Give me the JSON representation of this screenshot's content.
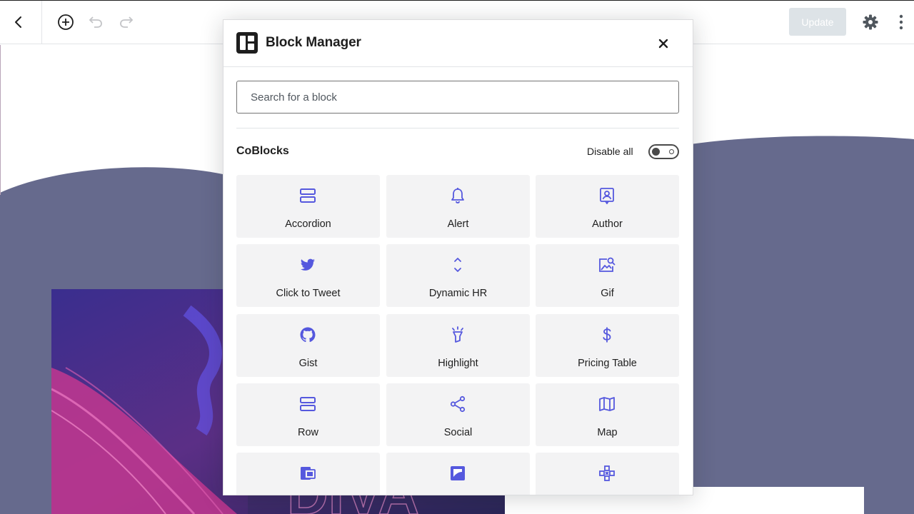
{
  "toolbar": {
    "back_icon": "chevron-left-icon",
    "add_icon": "plus-circle-icon",
    "undo_icon": "undo-icon",
    "redo_icon": "redo-icon",
    "update_label": "Update",
    "settings_icon": "gear-icon",
    "more_icon": "vertical-ellipsis-icon"
  },
  "modal": {
    "title": "Block Manager",
    "logo_icon": "coblocks-logo-icon",
    "close_icon": "close-icon",
    "search_placeholder": "Search for a block",
    "category": {
      "title": "CoBlocks",
      "disable_all_label": "Disable all",
      "toggle_on": true
    },
    "blocks": [
      {
        "label": "Accordion",
        "icon": "accordion-icon"
      },
      {
        "label": "Alert",
        "icon": "bell-icon"
      },
      {
        "label": "Author",
        "icon": "author-icon"
      },
      {
        "label": "Click to Tweet",
        "icon": "twitter-icon"
      },
      {
        "label": "Dynamic HR",
        "icon": "expand-vertical-icon"
      },
      {
        "label": "Gif",
        "icon": "gif-search-icon"
      },
      {
        "label": "Gist",
        "icon": "github-icon"
      },
      {
        "label": "Highlight",
        "icon": "highlighter-icon"
      },
      {
        "label": "Pricing Table",
        "icon": "dollar-icon"
      },
      {
        "label": "Row",
        "icon": "row-icon"
      },
      {
        "label": "Social",
        "icon": "share-icon"
      },
      {
        "label": "Map",
        "icon": "map-icon"
      },
      {
        "label": "",
        "icon": "media-card-icon"
      },
      {
        "label": "",
        "icon": "shape-divider-icon"
      },
      {
        "label": "",
        "icon": "features-icon"
      }
    ]
  },
  "colors": {
    "accent": "#5558de",
    "canvas_purple": "#666a8d",
    "tile_bg": "#f3f3f4",
    "update_disabled": "#dde3e7"
  }
}
